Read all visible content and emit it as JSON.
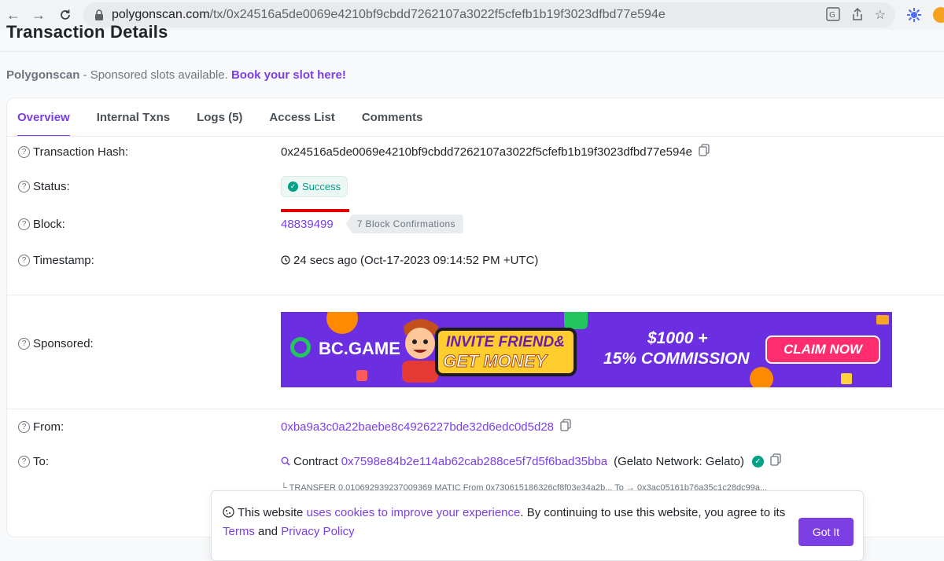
{
  "browser": {
    "url_host": "polygonscan.com",
    "url_path": "/tx/0x24516a5de0069e4210bf9cbdd7262107a3022f5cfefb1b19f3023dfbd77e594e",
    "icons": [
      "back-icon",
      "forward-icon",
      "reload-icon",
      "lock-icon",
      "translate-icon",
      "share-icon",
      "bookmark-star-icon",
      "extension-icon",
      "profile-icon"
    ]
  },
  "page": {
    "title": "Transaction Details",
    "sponsor": {
      "brand": "Polygonscan",
      "text": " - Sponsored slots available. ",
      "link": "Book your slot here!"
    }
  },
  "tabs": [
    {
      "label": "Overview",
      "active": true
    },
    {
      "label": "Internal Txns",
      "active": false
    },
    {
      "label": "Logs (5)",
      "active": false
    },
    {
      "label": "Access List",
      "active": false
    },
    {
      "label": "Comments",
      "active": false
    }
  ],
  "details": {
    "hash": {
      "label": "Transaction Hash:",
      "value": "0x24516a5de0069e4210bf9cbdd7262107a3022f5cfefb1b19f3023dfbd77e594e"
    },
    "status": {
      "label": "Status:",
      "value": "Success"
    },
    "block": {
      "label": "Block:",
      "value": "48839499",
      "confirmations": "7 Block Confirmations"
    },
    "timestamp": {
      "label": "Timestamp:",
      "value": "24 secs ago (Oct-17-2023 09:14:52 PM +UTC)"
    },
    "sponsored": {
      "label": "Sponsored:"
    },
    "from": {
      "label": "From:",
      "value": "0xba9a3c0a22baebe8c4926227bde32d6edc0d5d28"
    },
    "to": {
      "label": "To:",
      "prefix": "Contract",
      "address": "0x7598e84b2e114ab62cab288ce5f7d5f6bad35bba",
      "name": "(Gelato Network: Gelato)",
      "transfer": "└ TRANSFER  0.010692939237009369 MATIC From 0x730615186326cf8f03e34a2b...   To → 0x3ac05161b76a35c1c28dc99a..."
    }
  },
  "ad": {
    "brand": "BC.GAME",
    "line1": "INVITE FRIEND&",
    "line2": "GET MONEY",
    "bonus1": "$1000 +",
    "bonus2": "15% COMMISSION",
    "cta": "CLAIM NOW"
  },
  "cookie": {
    "pre": "This website ",
    "link1": "uses cookies to improve your experience",
    "mid": ". By continuing to use this website, you agree to its ",
    "link2": "Terms",
    "and": " and ",
    "link3": "Privacy Policy",
    "button": "Got It"
  },
  "colors": {
    "accent": "#7b3fe4",
    "success": "#00a186",
    "underline": "#e60000"
  }
}
